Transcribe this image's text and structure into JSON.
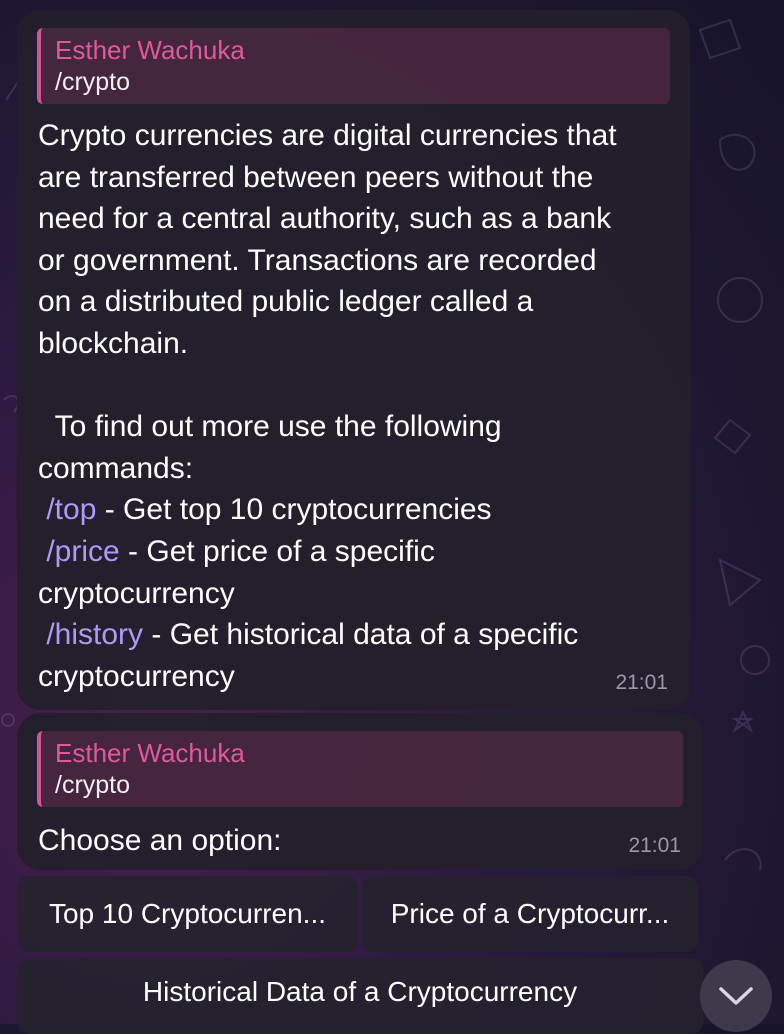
{
  "messages": [
    {
      "reply_to": {
        "author": "Esther Wachuka",
        "text": "/crypto"
      },
      "lines": [
        {
          "segments": [
            {
              "text": "Crypto currencies are digital currencies that"
            }
          ]
        },
        {
          "segments": [
            {
              "text": "are transferred between peers without the"
            }
          ]
        },
        {
          "segments": [
            {
              "text": "need for a central authority, such as a bank"
            }
          ]
        },
        {
          "segments": [
            {
              "text": "or government. Transactions are recorded"
            }
          ]
        },
        {
          "segments": [
            {
              "text": "on a distributed public ledger called a"
            }
          ]
        },
        {
          "segments": [
            {
              "text": "blockchain."
            }
          ]
        },
        {
          "segments": [
            {
              "text": ""
            }
          ]
        },
        {
          "segments": [
            {
              "text": "  To find out more use the following"
            }
          ]
        },
        {
          "segments": [
            {
              "text": "commands:"
            }
          ]
        },
        {
          "segments": [
            {
              "text": " "
            },
            {
              "text": "/top",
              "command": true
            },
            {
              "text": " - Get top 10 cryptocurrencies"
            }
          ]
        },
        {
          "segments": [
            {
              "text": " "
            },
            {
              "text": "/price",
              "command": true
            },
            {
              "text": " - Get price of a specific"
            }
          ]
        },
        {
          "segments": [
            {
              "text": "cryptocurrency"
            }
          ]
        },
        {
          "segments": [
            {
              "text": " "
            },
            {
              "text": "/history",
              "command": true
            },
            {
              "text": " - Get historical data of a specific"
            }
          ]
        },
        {
          "segments": [
            {
              "text": "cryptocurrency"
            }
          ]
        }
      ],
      "time": "21:01"
    },
    {
      "reply_to": {
        "author": "Esther Wachuka",
        "text": "/crypto"
      },
      "text": "Choose an option:",
      "time": "21:01"
    }
  ],
  "keyboard": {
    "top10_label": "Top 10 Cryptocurren...",
    "price_label": "Price of a Cryptocurr...",
    "history_label": "Historical Data of a Cryptocurrency"
  },
  "icons": {
    "scroll_down": "chevron-down-icon"
  },
  "colors": {
    "reply_author": "#e0589f",
    "command_link": "#a99bf6",
    "bubble": "#241f2c"
  }
}
